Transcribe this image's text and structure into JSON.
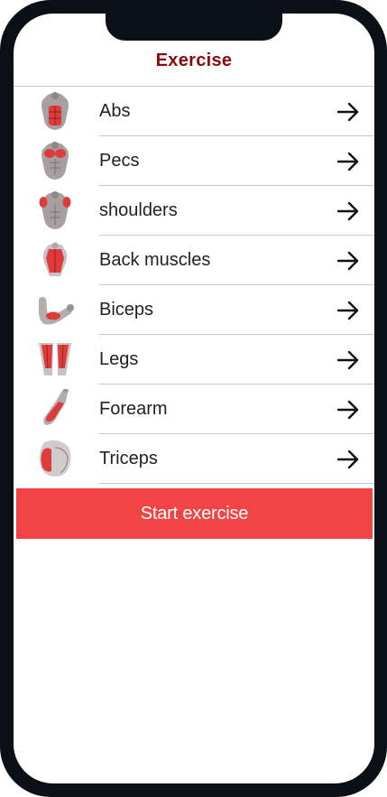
{
  "header": {
    "title": "Exercise"
  },
  "items": [
    {
      "label": "Abs",
      "icon": "abs-muscle-icon"
    },
    {
      "label": "Pecs",
      "icon": "pecs-muscle-icon"
    },
    {
      "label": "shoulders",
      "icon": "shoulders-muscle-icon"
    },
    {
      "label": "Back muscles",
      "icon": "back-muscle-icon"
    },
    {
      "label": "Biceps",
      "icon": "biceps-muscle-icon"
    },
    {
      "label": "Legs",
      "icon": "legs-muscle-icon"
    },
    {
      "label": "Forearm",
      "icon": "forearm-muscle-icon"
    },
    {
      "label": "Triceps",
      "icon": "triceps-muscle-icon"
    }
  ],
  "start_button": {
    "label": "Start exercise"
  },
  "colors": {
    "title": "#8b0a0a",
    "button": "#f24444",
    "muscle": "#e03b3b",
    "skin": "#a8a0a0"
  }
}
